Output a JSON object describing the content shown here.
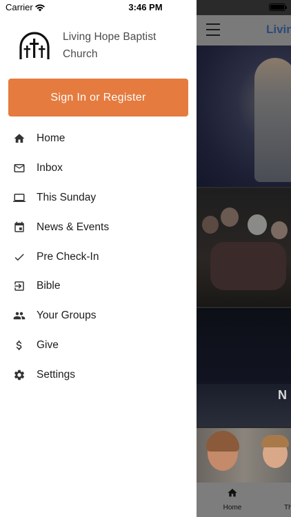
{
  "status_bar": {
    "carrier": "Carrier",
    "time": "3:46 PM"
  },
  "drawer": {
    "church_name": "Living Hope Baptist Church",
    "signin_label": "Sign In or Register",
    "accent_color": "#e57b3f",
    "menu": [
      {
        "label": "Home",
        "icon": "home-icon"
      },
      {
        "label": "Inbox",
        "icon": "mail-icon"
      },
      {
        "label": "This Sunday",
        "icon": "laptop-icon"
      },
      {
        "label": "News & Events",
        "icon": "calendar-icon"
      },
      {
        "label": "Pre Check-In",
        "icon": "checkmark-icon"
      },
      {
        "label": "Bible",
        "icon": "login-arrow-icon"
      },
      {
        "label": "Your Groups",
        "icon": "people-icon"
      },
      {
        "label": "Give",
        "icon": "dollar-icon"
      },
      {
        "label": "Settings",
        "icon": "gear-icon"
      }
    ]
  },
  "background_app": {
    "title": "Livin",
    "banner_text": "N",
    "tab_home_label": "Home",
    "tab_next_label": "Th"
  }
}
